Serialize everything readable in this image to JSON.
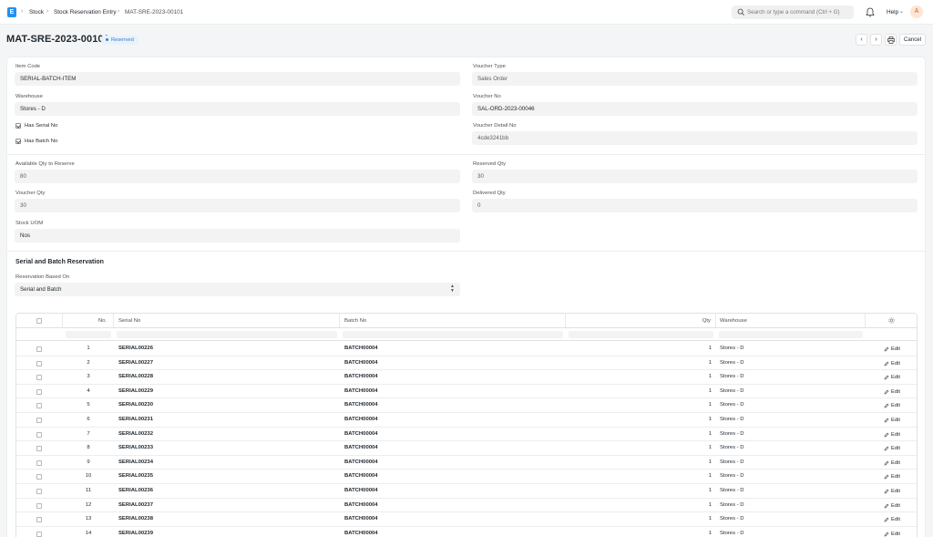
{
  "navbar": {
    "logo": "E",
    "breadcrumbs": [
      "Stock",
      "Stock Reservation Entry",
      "MAT-SRE-2023-00101"
    ],
    "search_placeholder": "Search or type a command (Ctrl + G)",
    "help_label": "Help",
    "avatar": "A"
  },
  "page": {
    "title": "MAT-SRE-2023-00101",
    "status": "Reserved",
    "cancel_label": "Cancel"
  },
  "form": {
    "item_code": {
      "label": "Item Code",
      "value": "SERIAL-BATCH-ITEM"
    },
    "warehouse": {
      "label": "Warehouse",
      "value": "Stores - D"
    },
    "has_serial_no": {
      "label": "Has Serial No",
      "checked": true
    },
    "has_batch_no": {
      "label": "Has Batch No",
      "checked": true
    },
    "voucher_type": {
      "label": "Voucher Type",
      "value": "Sales Order"
    },
    "voucher_no": {
      "label": "Voucher No",
      "value": "SAL-ORD-2023-00046"
    },
    "voucher_detail_no": {
      "label": "Voucher Detail No",
      "value": "4cde3241bb"
    },
    "available_qty": {
      "label": "Available Qty to Reserve",
      "value": "80"
    },
    "voucher_qty": {
      "label": "Voucher Qty",
      "value": "30"
    },
    "stock_uom": {
      "label": "Stock UOM",
      "value": "Nos"
    },
    "reserved_qty": {
      "label": "Reserved Qty",
      "value": "30"
    },
    "delivered_qty": {
      "label": "Delivered Qty",
      "value": "0"
    }
  },
  "reservation": {
    "section_title": "Serial and Batch Reservation",
    "based_on_label": "Reservation Based On",
    "based_on_value": "Serial and Batch",
    "columns": {
      "no": "No.",
      "serial": "Serial No",
      "batch": "Batch No",
      "qty": "Qty",
      "warehouse": "Warehouse"
    },
    "edit_label": "Edit",
    "rows": [
      {
        "no": "1",
        "serial": "SERIAL00226",
        "batch": "BATCH00004",
        "qty": "1",
        "warehouse": "Stores - D"
      },
      {
        "no": "2",
        "serial": "SERIAL00227",
        "batch": "BATCH00004",
        "qty": "1",
        "warehouse": "Stores - D"
      },
      {
        "no": "3",
        "serial": "SERIAL00228",
        "batch": "BATCH00004",
        "qty": "1",
        "warehouse": "Stores - D"
      },
      {
        "no": "4",
        "serial": "SERIAL00229",
        "batch": "BATCH00004",
        "qty": "1",
        "warehouse": "Stores - D"
      },
      {
        "no": "5",
        "serial": "SERIAL00230",
        "batch": "BATCH00004",
        "qty": "1",
        "warehouse": "Stores - D"
      },
      {
        "no": "6",
        "serial": "SERIAL00231",
        "batch": "BATCH00004",
        "qty": "1",
        "warehouse": "Stores - D"
      },
      {
        "no": "7",
        "serial": "SERIAL00232",
        "batch": "BATCH00004",
        "qty": "1",
        "warehouse": "Stores - D"
      },
      {
        "no": "8",
        "serial": "SERIAL00233",
        "batch": "BATCH00004",
        "qty": "1",
        "warehouse": "Stores - D"
      },
      {
        "no": "9",
        "serial": "SERIAL00234",
        "batch": "BATCH00004",
        "qty": "1",
        "warehouse": "Stores - D"
      },
      {
        "no": "10",
        "serial": "SERIAL00235",
        "batch": "BATCH00004",
        "qty": "1",
        "warehouse": "Stores - D"
      },
      {
        "no": "11",
        "serial": "SERIAL00236",
        "batch": "BATCH00004",
        "qty": "1",
        "warehouse": "Stores - D"
      },
      {
        "no": "12",
        "serial": "SERIAL00237",
        "batch": "BATCH00004",
        "qty": "1",
        "warehouse": "Stores - D"
      },
      {
        "no": "13",
        "serial": "SERIAL00238",
        "batch": "BATCH00004",
        "qty": "1",
        "warehouse": "Stores - D"
      },
      {
        "no": "14",
        "serial": "SERIAL00239",
        "batch": "BATCH00004",
        "qty": "1",
        "warehouse": "Stores - D"
      }
    ]
  }
}
